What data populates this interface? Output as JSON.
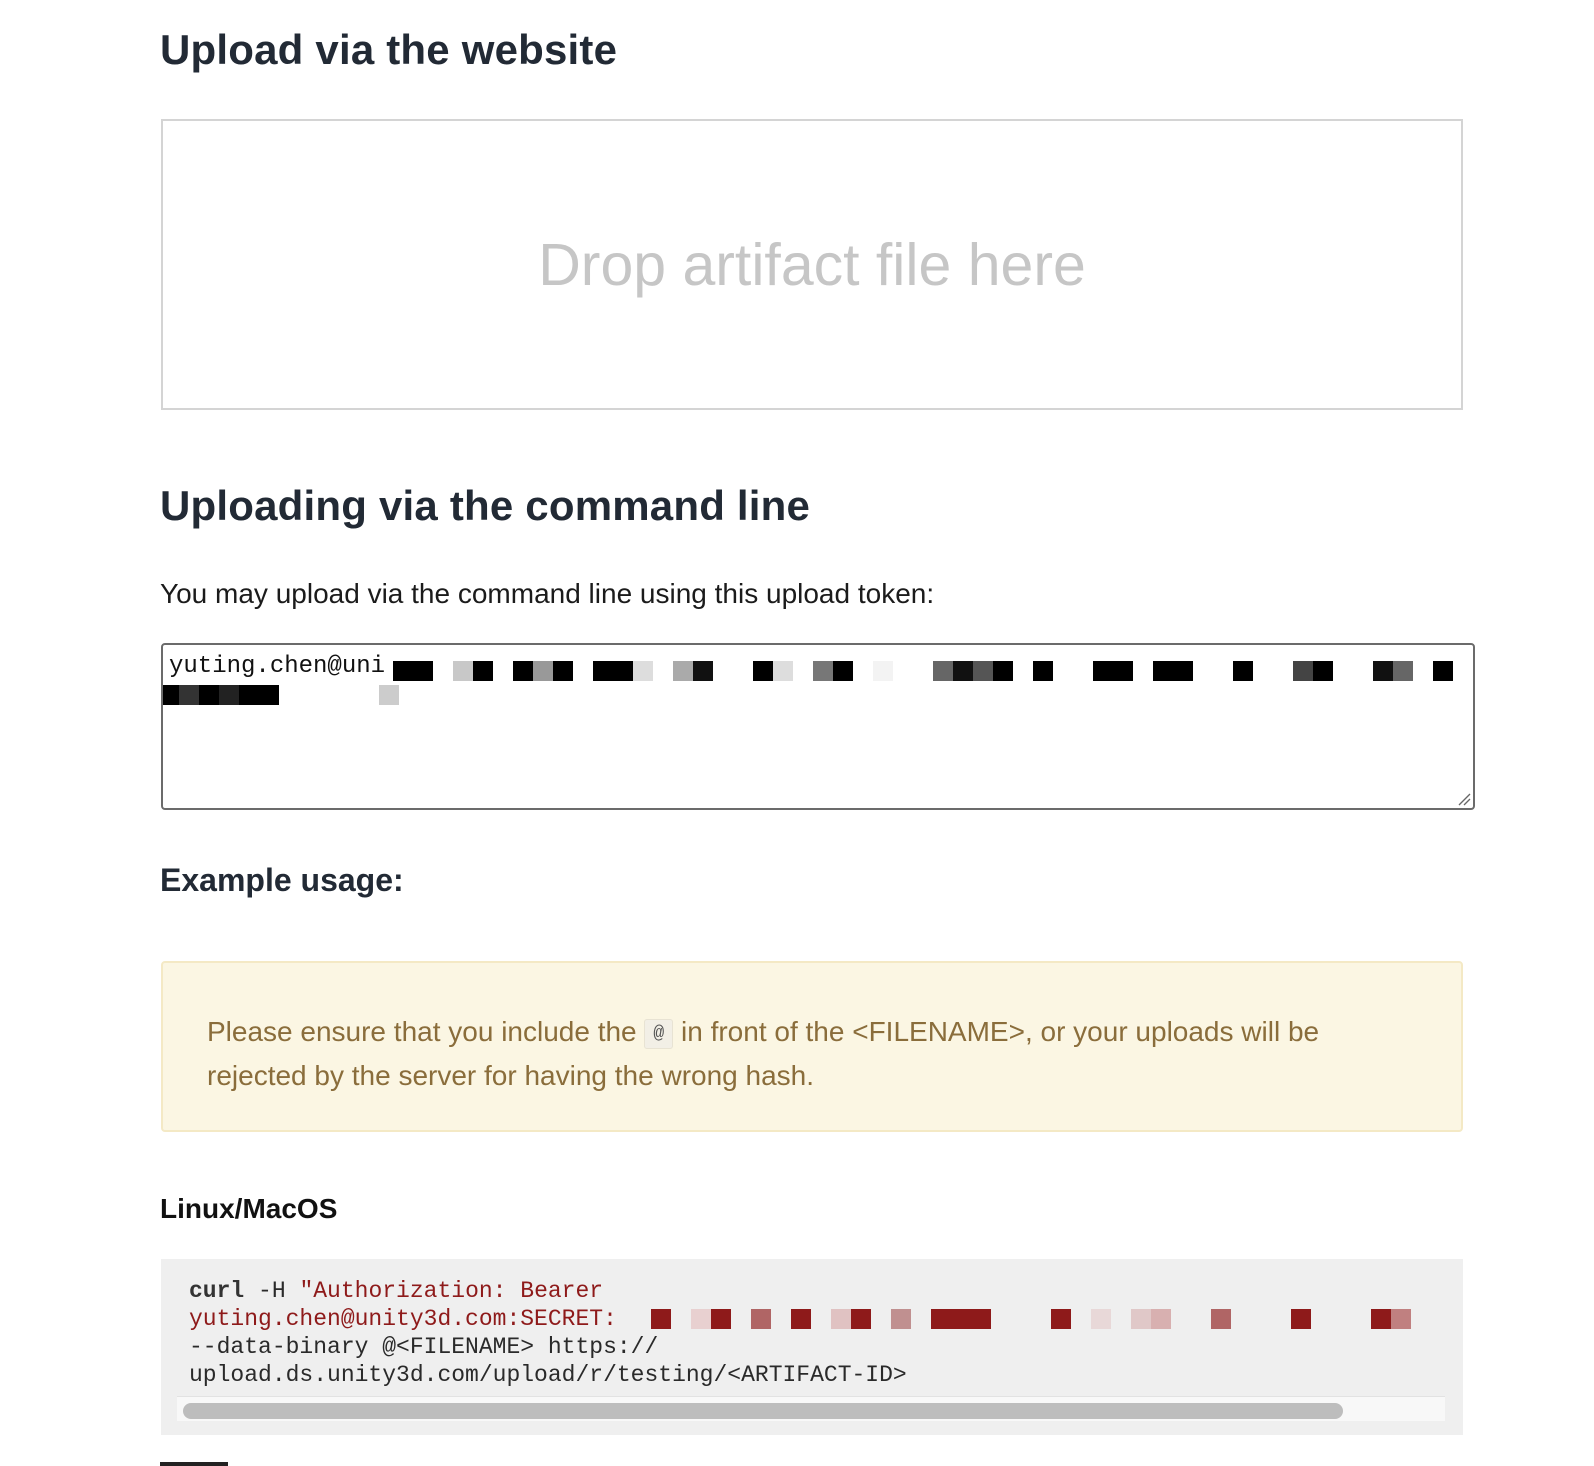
{
  "website_section": {
    "title": "Upload via the website",
    "dropzone_text": "Drop artifact file here"
  },
  "cli_section": {
    "title": "Uploading via the command line",
    "intro": "You may upload via the command line using this upload token:",
    "token_visible": "yuting.chen@uni"
  },
  "example": {
    "title": "Example usage:",
    "warning_before": "Please ensure that you include the",
    "warning_code": "@",
    "warning_after": "in front of the <FILENAME>, or your uploads will be rejected by the server for having the wrong hash."
  },
  "linux": {
    "title": "Linux/MacOS",
    "code_cmd": "curl",
    "code_flag": " -H ",
    "code_str1": "\"Authorization: Bearer",
    "code_str2": "yuting.chen@unity3d.com:SECRET:",
    "code_line3": "--data-binary @<FILENAME> https://",
    "code_line4": "upload.ds.unity3d.com/upload/r/testing/<ARTIFACT-ID>"
  }
}
